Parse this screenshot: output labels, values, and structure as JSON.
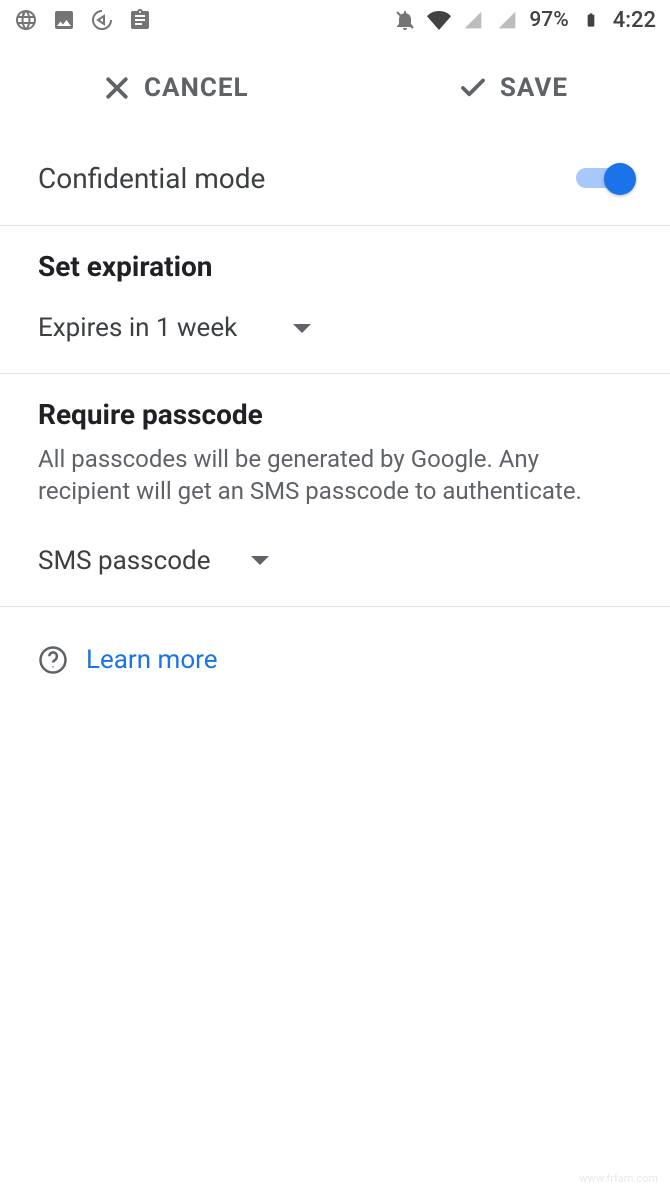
{
  "status_bar": {
    "battery_pct": "97%",
    "time": "4:22"
  },
  "actions": {
    "cancel": "CANCEL",
    "save": "SAVE"
  },
  "confidential_mode": {
    "label": "Confidential mode",
    "enabled": true
  },
  "expiration": {
    "title": "Set expiration",
    "selected": "Expires in 1 week"
  },
  "passcode": {
    "title": "Require passcode",
    "description": "All passcodes will be generated by Google. Any recipient will get an SMS passcode to authenticate.",
    "selected": "SMS passcode"
  },
  "learn_more": "Learn more",
  "watermark": "www.frfam.com"
}
